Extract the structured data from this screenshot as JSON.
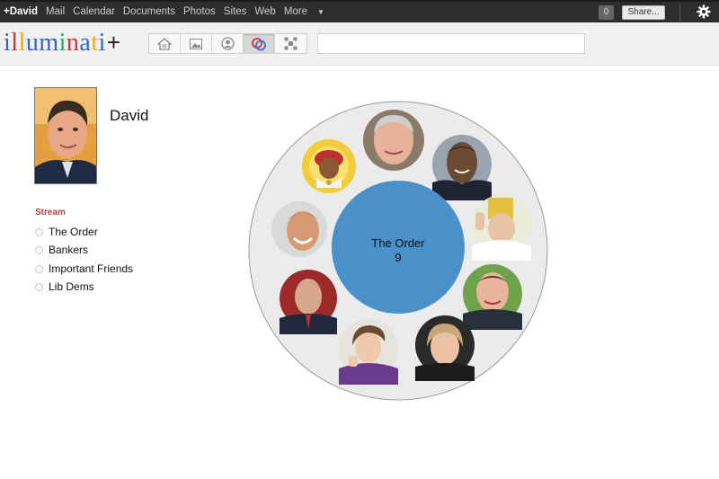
{
  "topbar": {
    "nav": [
      {
        "label": "+David",
        "active": true
      },
      {
        "label": "Mail"
      },
      {
        "label": "Calendar"
      },
      {
        "label": "Documents"
      },
      {
        "label": "Photos"
      },
      {
        "label": "Sites"
      },
      {
        "label": "Web"
      },
      {
        "label": "More"
      }
    ],
    "notification_count": "0",
    "share_label": "Share...",
    "settings_icon": "gear-icon"
  },
  "header": {
    "logo_letters": [
      {
        "ch": "i",
        "color": "#3366cc"
      },
      {
        "ch": "l",
        "color": "#cc3333"
      },
      {
        "ch": "l",
        "color": "#f2a900"
      },
      {
        "ch": "u",
        "color": "#3366cc"
      },
      {
        "ch": "m",
        "color": "#3366cc"
      },
      {
        "ch": "i",
        "color": "#33aa55"
      },
      {
        "ch": "n",
        "color": "#cc3333"
      },
      {
        "ch": "a",
        "color": "#3366cc"
      },
      {
        "ch": "t",
        "color": "#f2a900"
      },
      {
        "ch": "i",
        "color": "#3366cc"
      }
    ],
    "logo_plus": "+",
    "toolbar_icons": [
      "home-icon",
      "photos-icon",
      "profile-icon",
      "circles-icon",
      "games-icon"
    ],
    "search_value": ""
  },
  "profile": {
    "name": "David"
  },
  "stream": {
    "title": "Stream",
    "items": [
      "The Order",
      "Bankers",
      "Important Friends",
      "Lib Dems"
    ]
  },
  "circle": {
    "name": "The Order",
    "count": "9",
    "colors": {
      "outer": "#ebebeb",
      "outer_border": "#9a9a9a",
      "inner": "#4a90c9"
    }
  }
}
